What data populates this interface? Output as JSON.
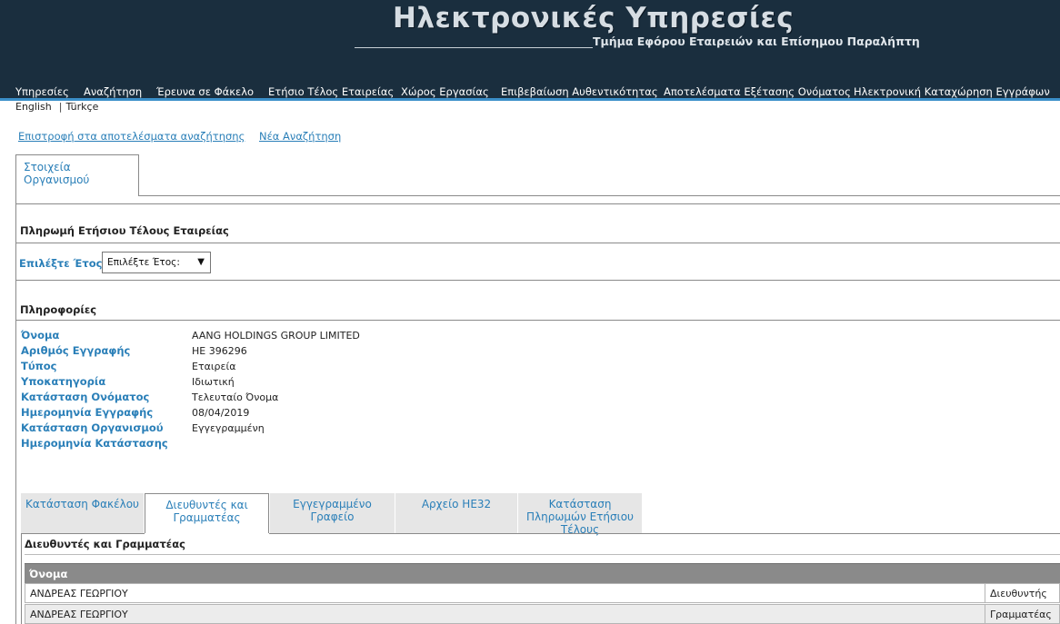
{
  "header": {
    "title": "Ηλεκτρονικές Υπηρεσίες",
    "subtitle": "Τμήμα Εφόρου Εταιρειών και Επίσημου Παραλήπτη"
  },
  "nav": [
    "Υπηρεσίες",
    "Αναζήτηση",
    "Έρευνα σε Φάκελο",
    "Ετήσιο Τέλος Εταιρείας",
    "Χώρος Εργασίας",
    "Επιβεβαίωση Αυθεντικότητας",
    "Αποτελέσματα Εξέτασης Ονόματος",
    "Ηλεκτρονική Καταχώρηση Εγγράφων"
  ],
  "languages": {
    "english": "English",
    "separator": "|",
    "turkish": "Türkçe"
  },
  "links": {
    "back": "Επιστροφή στα αποτελέσματα αναζήτησης",
    "new_search": "Νέα Αναζήτηση"
  },
  "main_tab": "Στοιχεία Οργανισμού",
  "payment": {
    "title": "Πληρωμή Ετήσιου Τέλους Εταιρείας",
    "year_label": "Επιλέξτε Έτος:",
    "year_selected": "Επιλέξτε Έτος:",
    "dropdown_arrow": "▼"
  },
  "info": {
    "title": "Πληροφορίες",
    "rows": [
      {
        "label": "Όνομα",
        "value": "AANG HOLDINGS GROUP LIMITED"
      },
      {
        "label": "Αριθμός Εγγραφής",
        "value": "ΗΕ 396296"
      },
      {
        "label": "Τύπος",
        "value": "Εταιρεία"
      },
      {
        "label": "Υποκατηγορία",
        "value": "Ιδιωτική"
      },
      {
        "label": "Κατάσταση Ονόματος",
        "value": "Τελευταίο Όνομα"
      },
      {
        "label": "Ημερομηνία Εγγραφής",
        "value": "08/04/2019"
      },
      {
        "label": "Κατάσταση Οργανισμού",
        "value": "Εγγεγραμμένη"
      },
      {
        "label": "Ημερομηνία Κατάστασης",
        "value": ""
      }
    ]
  },
  "subtabs": [
    "Κατάσταση Φακέλου",
    "Διευθυντές και Γραμματέας",
    "Εγγεγραμμένο Γραφείο",
    "Αρχείο ΗΕ32",
    "Κατάσταση Πληρωμών Ετήσιου Τέλους"
  ],
  "directors": {
    "title": "Διευθυντές και Γραμματέας",
    "column_name": "Όνομα",
    "rows": [
      {
        "name": "ΑΝΔΡΕΑΣ ΓΕΩΡΓΙΟΥ",
        "role": "Διευθυντής"
      },
      {
        "name": "ΑΝΔΡΕΑΣ ΓΕΩΡΓΙΟΥ",
        "role": "Γραμματέας"
      }
    ]
  }
}
